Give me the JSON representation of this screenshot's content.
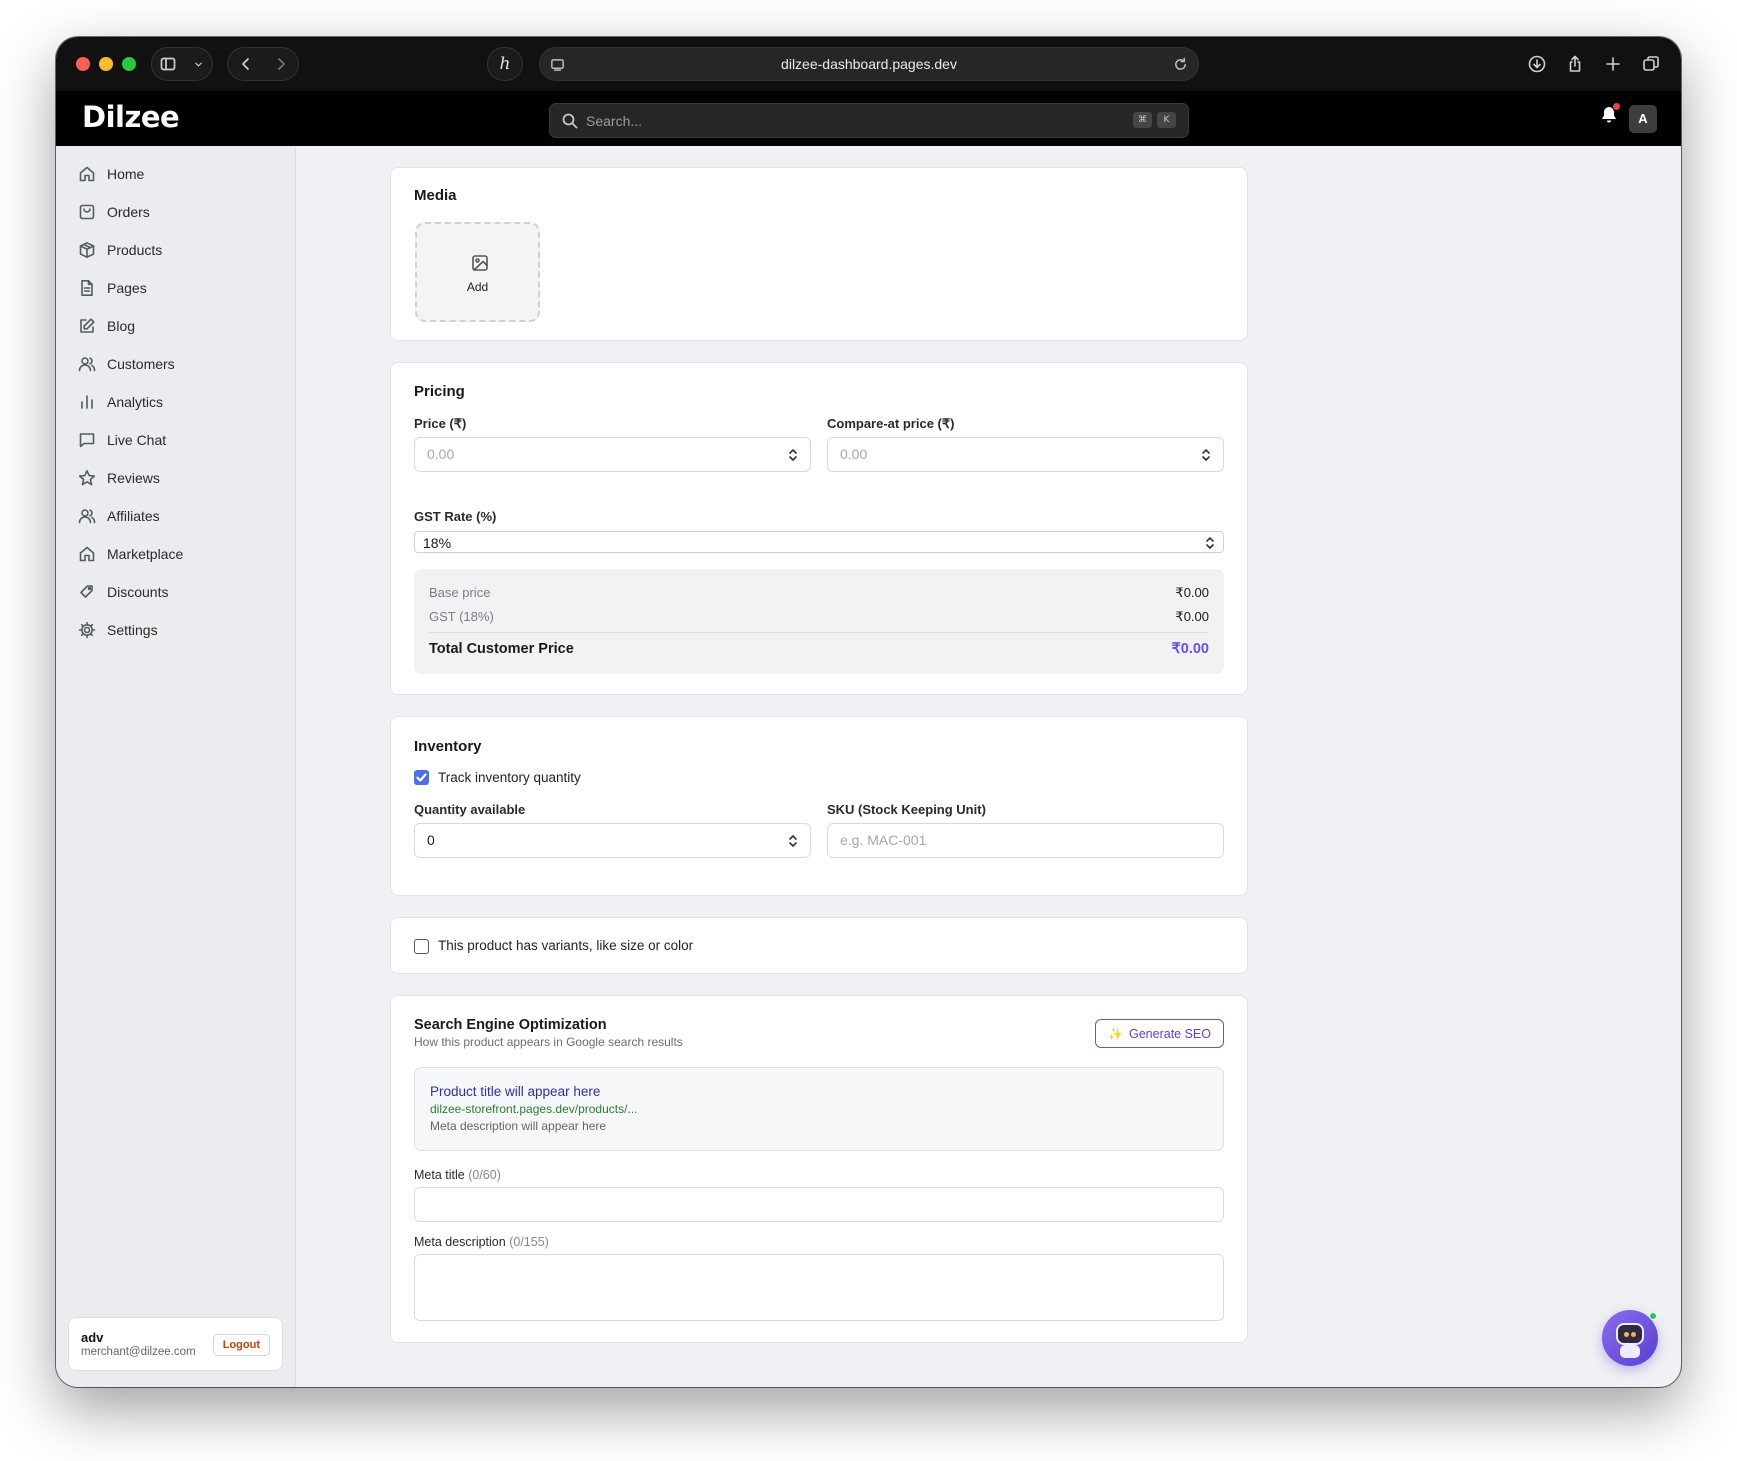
{
  "browser": {
    "url": "dilzee-dashboard.pages.dev"
  },
  "header": {
    "logo": "Dilzee",
    "search_placeholder": "Search...",
    "shortcut_keys": [
      "⌘",
      "K"
    ],
    "avatar_initial": "A"
  },
  "sidebar": {
    "items": [
      {
        "label": "Home",
        "icon": "home-icon"
      },
      {
        "label": "Orders",
        "icon": "shopping-bag-icon"
      },
      {
        "label": "Products",
        "icon": "box-icon"
      },
      {
        "label": "Pages",
        "icon": "document-icon"
      },
      {
        "label": "Blog",
        "icon": "edit-icon"
      },
      {
        "label": "Customers",
        "icon": "users-icon"
      },
      {
        "label": "Analytics",
        "icon": "bar-chart-icon"
      },
      {
        "label": "Live Chat",
        "icon": "chat-icon"
      },
      {
        "label": "Reviews",
        "icon": "star-icon"
      },
      {
        "label": "Affiliates",
        "icon": "users-icon"
      },
      {
        "label": "Marketplace",
        "icon": "store-icon"
      },
      {
        "label": "Discounts",
        "icon": "tag-icon"
      },
      {
        "label": "Settings",
        "icon": "gear-icon"
      }
    ],
    "user": {
      "name": "adv",
      "email": "merchant@dilzee.com",
      "logout_label": "Logout"
    }
  },
  "media": {
    "title": "Media",
    "add_label": "Add"
  },
  "pricing": {
    "title": "Pricing",
    "price_label": "Price (₹)",
    "price_placeholder": "0.00",
    "compare_label": "Compare-at price (₹)",
    "compare_placeholder": "0.00",
    "gst_label": "GST Rate (%)",
    "gst_value": "18%",
    "base_price_label": "Base price",
    "base_price_value": "₹0.00",
    "gst_row_label": "GST (18%)",
    "gst_row_value": "₹0.00",
    "total_label": "Total Customer Price",
    "total_value": "₹0.00"
  },
  "inventory": {
    "title": "Inventory",
    "track_label": "Track inventory quantity",
    "track_checked": true,
    "quantity_label": "Quantity available",
    "quantity_value": "0",
    "sku_label": "SKU (Stock Keeping Unit)",
    "sku_placeholder": "e.g. MAC-001"
  },
  "variants": {
    "label": "This product has variants, like size or color",
    "checked": false
  },
  "seo": {
    "title": "Search Engine Optimization",
    "subtitle": "How this product appears in Google search results",
    "generate_label": "Generate SEO",
    "preview_title": "Product title will appear here",
    "preview_url": "dilzee-storefront.pages.dev/products/...",
    "preview_desc": "Meta description will appear here",
    "meta_title_label": "Meta title",
    "meta_title_count": "(0/60)",
    "meta_desc_label": "Meta description",
    "meta_desc_count": "(0/155)"
  },
  "colors": {
    "accent": "#6d4de6",
    "checkbox": "#4f6fe8"
  }
}
